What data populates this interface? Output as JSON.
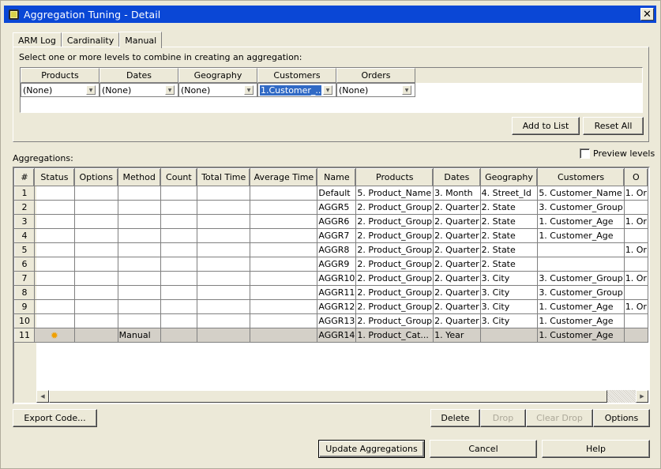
{
  "window": {
    "title": "Aggregation Tuning - Detail",
    "close_label": "✕"
  },
  "tabs": [
    {
      "label": "ARM Log",
      "active": false
    },
    {
      "label": "Cardinality",
      "active": false
    },
    {
      "label": "Manual",
      "active": true
    }
  ],
  "manual": {
    "instruction": "Select one or more levels to combine in creating an aggregation:",
    "levels": [
      {
        "dimension": "Products",
        "value": "(None)",
        "selected": false
      },
      {
        "dimension": "Dates",
        "value": "(None)",
        "selected": false
      },
      {
        "dimension": "Geography",
        "value": "(None)",
        "selected": false
      },
      {
        "dimension": "Customers",
        "value": "1.Customer_...",
        "selected": true
      },
      {
        "dimension": "Orders",
        "value": "(None)",
        "selected": false
      }
    ],
    "add_to_list_label": "Add to List",
    "reset_all_label": "Reset All"
  },
  "aggregations": {
    "label": "Aggregations:",
    "preview_levels_label": "Preview levels",
    "preview_levels_checked": false,
    "columns": [
      "#",
      "Status",
      "Options",
      "Method",
      "Count",
      "Total Time",
      "Average Time",
      "Name",
      "Products",
      "Dates",
      "Geography",
      "Customers",
      "O"
    ],
    "rows": [
      {
        "num": "1",
        "status": "",
        "options": "",
        "method": "",
        "count": "",
        "total_time": "",
        "average_time": "",
        "name": "Default",
        "products": "5. Product_Name",
        "dates": "3. Month",
        "geography": "4. Street_Id",
        "customers": "5. Customer_Name",
        "orders": "1. Or"
      },
      {
        "num": "2",
        "status": "",
        "options": "",
        "method": "",
        "count": "",
        "total_time": "",
        "average_time": "",
        "name": "AGGR5",
        "products": "2. Product_Group",
        "dates": "2. Quarter",
        "geography": "2. State",
        "customers": "3. Customer_Group",
        "orders": ""
      },
      {
        "num": "3",
        "status": "",
        "options": "",
        "method": "",
        "count": "",
        "total_time": "",
        "average_time": "",
        "name": "AGGR6",
        "products": "2. Product_Group",
        "dates": "2. Quarter",
        "geography": "2. State",
        "customers": "1. Customer_Age",
        "orders": "1. Or"
      },
      {
        "num": "4",
        "status": "",
        "options": "",
        "method": "",
        "count": "",
        "total_time": "",
        "average_time": "",
        "name": "AGGR7",
        "products": "2. Product_Group",
        "dates": "2. Quarter",
        "geography": "2. State",
        "customers": "1. Customer_Age",
        "orders": ""
      },
      {
        "num": "5",
        "status": "",
        "options": "",
        "method": "",
        "count": "",
        "total_time": "",
        "average_time": "",
        "name": "AGGR8",
        "products": "2. Product_Group",
        "dates": "2. Quarter",
        "geography": "2. State",
        "customers": "",
        "orders": "1. Or"
      },
      {
        "num": "6",
        "status": "",
        "options": "",
        "method": "",
        "count": "",
        "total_time": "",
        "average_time": "",
        "name": "AGGR9",
        "products": "2. Product_Group",
        "dates": "2. Quarter",
        "geography": "2. State",
        "customers": "",
        "orders": ""
      },
      {
        "num": "7",
        "status": "",
        "options": "",
        "method": "",
        "count": "",
        "total_time": "",
        "average_time": "",
        "name": "AGGR10",
        "products": "2. Product_Group",
        "dates": "2. Quarter",
        "geography": "3. City",
        "customers": "3. Customer_Group",
        "orders": "1. Or"
      },
      {
        "num": "8",
        "status": "",
        "options": "",
        "method": "",
        "count": "",
        "total_time": "",
        "average_time": "",
        "name": "AGGR11",
        "products": "2. Product_Group",
        "dates": "2. Quarter",
        "geography": "3. City",
        "customers": "3. Customer_Group",
        "orders": ""
      },
      {
        "num": "9",
        "status": "",
        "options": "",
        "method": "",
        "count": "",
        "total_time": "",
        "average_time": "",
        "name": "AGGR12",
        "products": "2. Product_Group",
        "dates": "2. Quarter",
        "geography": "3. City",
        "customers": "1. Customer_Age",
        "orders": "1. Or"
      },
      {
        "num": "10",
        "status": "",
        "options": "",
        "method": "",
        "count": "",
        "total_time": "",
        "average_time": "",
        "name": "AGGR13",
        "products": "2. Product_Group",
        "dates": "2. Quarter",
        "geography": "3. City",
        "customers": "1. Customer_Age",
        "orders": ""
      },
      {
        "num": "11",
        "status": "new-sun-icon",
        "options": "",
        "method": "Manual",
        "count": "",
        "total_time": "",
        "average_time": "",
        "name": "AGGR14",
        "products": "1. Product_Cat...",
        "dates": "1. Year",
        "geography": "",
        "customers": "1. Customer_Age",
        "orders": "",
        "selected": true
      }
    ]
  },
  "buttons": {
    "export_code": "Export Code...",
    "delete": "Delete",
    "drop": "Drop",
    "clear_drop": "Clear Drop",
    "options": "Options",
    "update_aggregations": "Update Aggregations",
    "cancel": "Cancel",
    "help": "Help"
  }
}
